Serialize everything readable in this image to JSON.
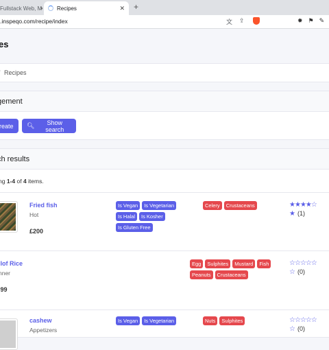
{
  "browser": {
    "tabs": [
      {
        "label": "Fullstack Web, Mo",
        "active": false
      },
      {
        "label": "Recipes",
        "active": true
      }
    ],
    "url": ".inspeqo.com/recipe/index"
  },
  "page": {
    "title": "es",
    "breadcrumb": {
      "separator": "/",
      "current": "Recipes"
    }
  },
  "management": {
    "title": "gement",
    "create_label": "reate",
    "show_search_label": "Show search"
  },
  "results": {
    "title": "ch results",
    "summary_prefix": "ng ",
    "summary_range": "1-4",
    "summary_of": " of ",
    "summary_total": "4",
    "summary_suffix": " items."
  },
  "recipes": [
    {
      "name": "Fried fish",
      "category": "Hot",
      "price": "£200",
      "diet_tags": [
        "Is Vegan",
        "Is Vegetarian",
        "Is Halal",
        "Is Kosher",
        "Is Gluten Free"
      ],
      "allergens": [
        "Celery",
        "Crustaceans"
      ],
      "stars": 4,
      "votes": "(1)"
    },
    {
      "name": "llof Rice",
      "category": "nner",
      "price": ".99",
      "diet_tags": [],
      "allergens": [
        "Egg",
        "Sulphites",
        "Mustard",
        "Fish",
        "Peanuts",
        "Crustaceans"
      ],
      "stars": 0,
      "votes": "(0)"
    },
    {
      "name": "cashew",
      "category": "Appetizers",
      "price": "",
      "diet_tags": [
        "Is Vegan",
        "Is Vegetarian"
      ],
      "allergens": [
        "Nuts",
        "Sulphites"
      ],
      "stars": 0,
      "votes": "(0)"
    }
  ],
  "colors": {
    "primary": "#5b5fe8",
    "danger": "#e5484d"
  }
}
